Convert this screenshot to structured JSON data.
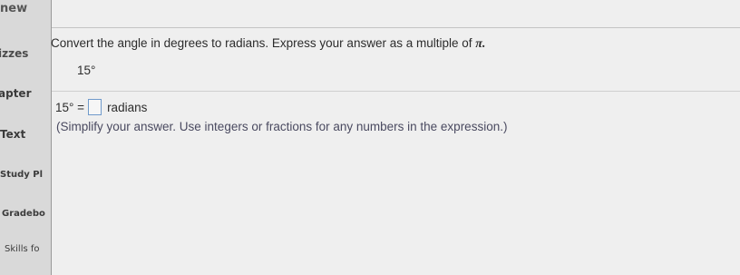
{
  "sidebar": {
    "top_label": "new",
    "items": [
      {
        "label": "izzes"
      },
      {
        "label": "apter"
      },
      {
        "label": "Text"
      },
      {
        "label": "Study Pl"
      },
      {
        "label": "Gradebo"
      },
      {
        "label": "Skills fo"
      }
    ]
  },
  "question": {
    "prompt": "Convert the angle in degrees to radians. Express your answer as a multiple of ",
    "prompt_symbol": "π.",
    "given": "15°",
    "answer_lhs": "15° =",
    "answer_value": "",
    "answer_units": "radians",
    "hint": "(Simplify your answer. Use integers or fractions for any numbers in the expression.)"
  }
}
